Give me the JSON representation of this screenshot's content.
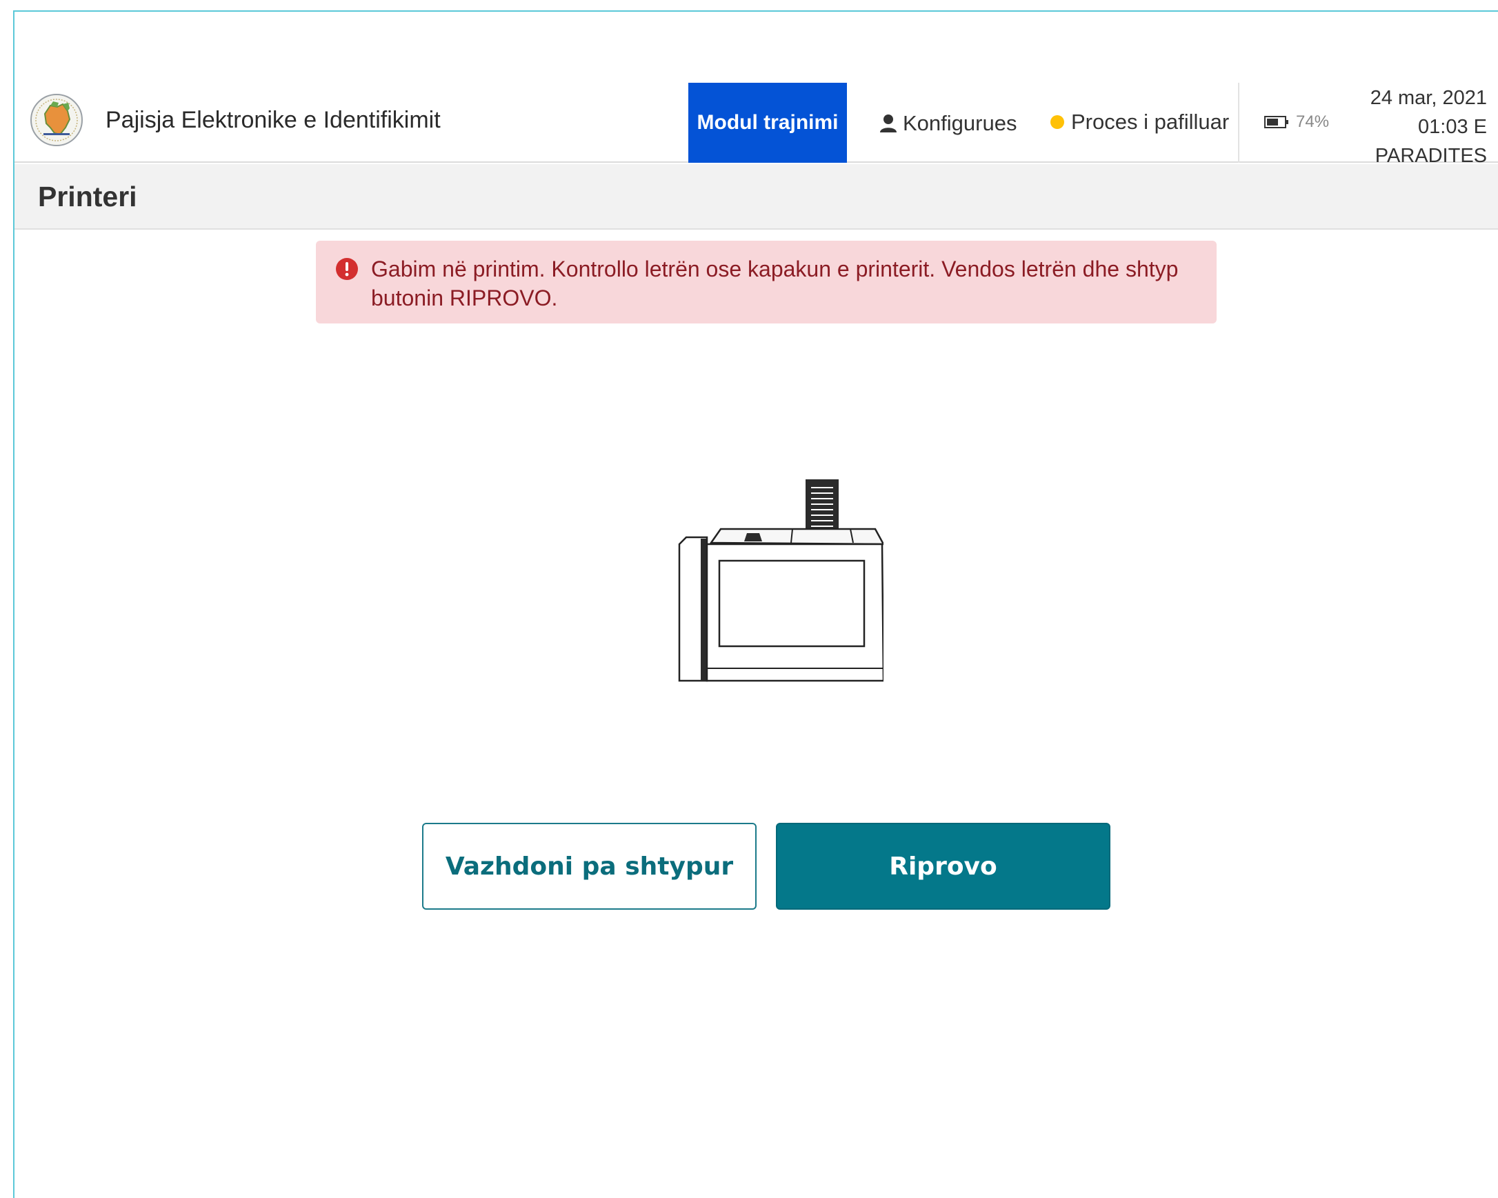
{
  "header": {
    "app_title": "Pajisja Elektronike e Identifikimit",
    "training_tab": "Modul trajnimi",
    "user_role": "Konfigurues",
    "process_status": "Proces i pafilluar",
    "battery_level": "74%",
    "date": "24 mar, 2021",
    "time": "01:03 E",
    "period": "PARADITES",
    "colors": {
      "accent": "#0453d6",
      "status_dot": "#ffc107"
    },
    "icons": {
      "user": "user-icon",
      "battery": "battery-icon",
      "logo": "emblem-logo"
    }
  },
  "page": {
    "title": "Printeri"
  },
  "alert": {
    "message": "Gabim në printim. Kontrollo letrën ose kapakun e printerit. Vendos letrën dhe shtyp butonin RIPROVO.",
    "icon": "error-icon",
    "colors": {
      "background": "#f8d7da",
      "text": "#8b1c24",
      "icon": "#d32f2f"
    }
  },
  "illustration": {
    "icon": "printer-device-icon"
  },
  "actions": {
    "continue_without_print": "Vazhdoni pa shtypur",
    "retry": "Riprovo",
    "colors": {
      "primary": "#04788a"
    }
  }
}
